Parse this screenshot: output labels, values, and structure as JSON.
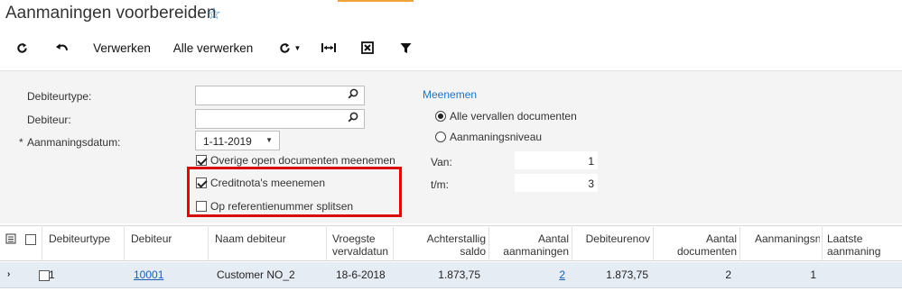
{
  "header": {
    "title": "Aanmaningen voorbereiden",
    "star_glyph": "☆",
    "accent": "#f2a33a"
  },
  "toolbar": {
    "refresh_glyph": "C",
    "undo_glyph": "↶",
    "process_label": "Verwerken",
    "process_all_label": "Alle verwerken",
    "toggle_glyph": "↻ ▾",
    "fit_glyph": "|↔|",
    "excel_glyph": "✖",
    "filter_glyph": "▼"
  },
  "filters": {
    "debtor_type_label": "Debiteurtype:",
    "debtor_label": "Debiteur:",
    "dunning_date_label": "Aanmaningsdatum:",
    "required_mark": "*",
    "dunning_date_value": "1-11-2019",
    "other_open_docs_label": "Overige open documenten meenemen",
    "credit_notes_label": "Creditnota's meenemen",
    "split_ref_label": "Op referentienummer splitsen",
    "include_title": "Meenemen",
    "all_overdue_label": "Alle vervallen documenten",
    "dunning_level_label": "Aanmaningsniveau",
    "from_label": "Van:",
    "from_value": "1",
    "to_label": "t/m:",
    "to_value": "3",
    "other_open_docs_checked": true,
    "credit_notes_checked": true,
    "split_ref_checked": false,
    "selected_option": "all_overdue",
    "highlight_color": "#d90c0c"
  },
  "grid": {
    "columns": [
      "Debiteurtype",
      "Debiteur",
      "Naam debiteur",
      "Vroegste vervaldatun",
      "Achterstallig saldo",
      "Aantal aanmaningen",
      "Debiteurenov",
      "Aantal documenten",
      "Aanmaningsni",
      "Laatste aanmaning"
    ],
    "rows": [
      {
        "debtor_type": "1",
        "debtor": "10001",
        "debtor_name": "Customer NO_2",
        "earliest_due": "18-6-2018",
        "overdue_balance": "1.873,75",
        "dunning_count": "2",
        "debtor_balance": "1.873,75",
        "doc_count": "2",
        "dunning_level": "1",
        "last_dunning": ""
      }
    ]
  }
}
